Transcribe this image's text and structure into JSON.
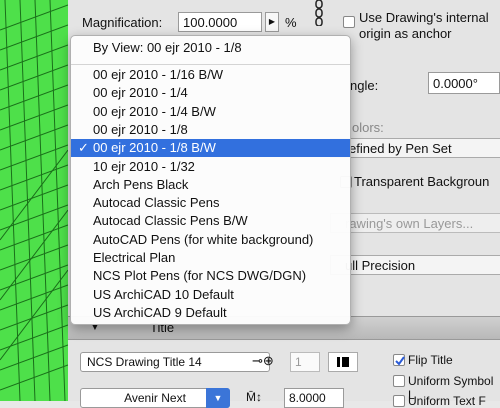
{
  "magnification": {
    "label": "Magnification:",
    "value": "100.0000",
    "unit": "%"
  },
  "anchor": {
    "label_line1": "Use Drawing's internal",
    "label_line2": "origin as anchor",
    "checked": false
  },
  "angle": {
    "label": "ngle:",
    "value": "0.0000°"
  },
  "colors": {
    "label": "olors:"
  },
  "pen_select": {
    "value": "efined by Pen Set"
  },
  "transparent": {
    "label": "Transparent Backgroun"
  },
  "layers_select": {
    "value": "rawing's own Layers..."
  },
  "precision_select": {
    "value": "ull Precision"
  },
  "title_section": {
    "label": "Title"
  },
  "title_font": {
    "value": "NCS Drawing Title 14"
  },
  "pen_number": {
    "value": "1"
  },
  "flip_title": {
    "label": "Flip Title",
    "checked": true
  },
  "uniform_symbol": {
    "label": "Uniform Symbol L",
    "checked": false
  },
  "uniform_text": {
    "label": "Uniform Text F",
    "checked": false
  },
  "typeface": {
    "value": "Avenir Next"
  },
  "text_size": {
    "value": "8.0000"
  },
  "menu": {
    "header_item": "By View: 00 ejr 2010 - 1/8",
    "items": [
      "00 ejr 2010 - 1/16 B/W",
      "00 ejr 2010 - 1/4",
      "00 ejr 2010 - 1/4 B/W",
      "00 ejr 2010 - 1/8",
      "00 ejr 2010 - 1/8 B/W",
      "10 ejr 2010 - 1/32",
      "Arch Pens Black",
      "Autocad Classic Pens",
      "Autocad Classic Pens B/W",
      "AutoCAD Pens (for white background)",
      "Electrical Plan",
      "NCS Plot Pens (for NCS DWG/DGN)",
      "US ArchiCAD 10 Default",
      "US ArchiCAD 9 Default"
    ],
    "selected_index": 4,
    "check_glyph": "✓"
  },
  "colors_map": {
    "canvas_green": "#4ee04a",
    "selection_blue": "#3270de"
  }
}
